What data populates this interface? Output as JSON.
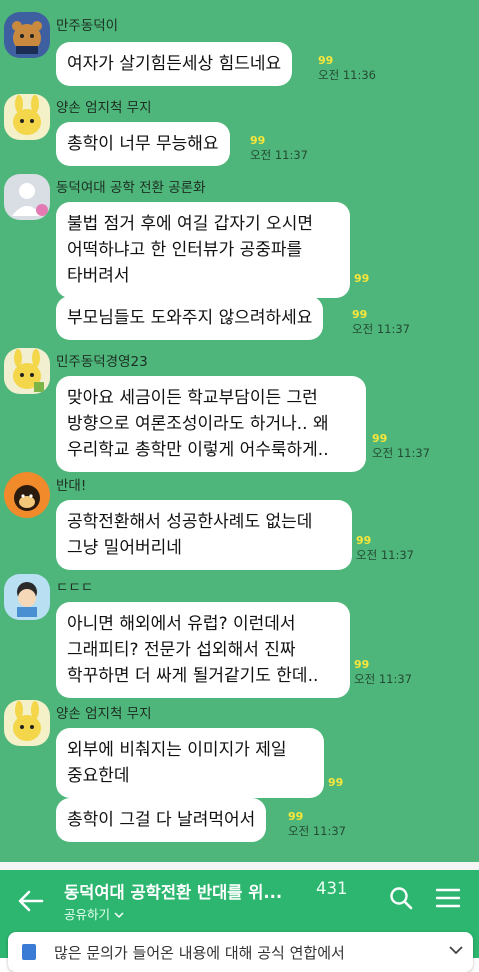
{
  "messages": [
    {
      "sender": "만주동덕이",
      "text": "여자가 살기힘든세상 힘드네요",
      "unread": "99",
      "time": "오전 11:36"
    },
    {
      "sender": "양손 엄지척 무지",
      "text": "총학이 너무 무능해요",
      "unread": "99",
      "time": "오전 11:37"
    },
    {
      "sender": "동덕여대 공학 전환 공론화",
      "lines": [
        "불법 점거 후에 여길 갑자기 오시면",
        "어떡하냐고 한 인터뷰가 공중파를",
        "타버려서"
      ],
      "unread": "99"
    },
    {
      "text": "부모님들도 도와주지 않으려하세요",
      "unread": "99",
      "time": "오전 11:37"
    },
    {
      "sender": "민주동덕경영23",
      "lines": [
        "맞아요 세금이든 학교부담이든 그런",
        "방향으로 여론조성이라도 하거나.. 왜",
        "우리학교 총학만 이렇게 어수룩하게.."
      ],
      "unread": "99",
      "time": "오전 11:37"
    },
    {
      "sender": "반대!",
      "lines": [
        "공학전환해서 성공한사례도 없는데",
        "그냥 밀어버리네"
      ],
      "unread": "99",
      "time": "오전 11:37"
    },
    {
      "sender": "ㄷㄷㄷ",
      "lines": [
        "아니면 해외에서 유럽? 이런데서",
        "그래피티? 전문가 섭외해서 진짜",
        "학꾸하면 더 싸게 될거같기도 한데.."
      ],
      "unread": "99",
      "time": "오전 11:37"
    },
    {
      "sender": "양손 엄지척 무지",
      "lines": [
        "외부에 비춰지는 이미지가 제일",
        "중요한데"
      ],
      "unread": "99"
    },
    {
      "text": "총학이 그걸 다 날려먹어서",
      "unread": "99",
      "time": "오전 11:37"
    }
  ],
  "header": {
    "title": "동덕여대 공학전환 반대를 위...",
    "member_count": "431",
    "share_label": "공유하기",
    "icons": [
      "back-arrow-icon",
      "search-icon",
      "menu-icon"
    ]
  },
  "notice": {
    "text": "많은 문의가 들어온 내용에 대해 공식 연합에서"
  },
  "colors": {
    "chat_background": "#4fb67b",
    "header_background": "#2cb66f",
    "unread_count": "#f7e63b",
    "bubble": "#ffffff"
  }
}
